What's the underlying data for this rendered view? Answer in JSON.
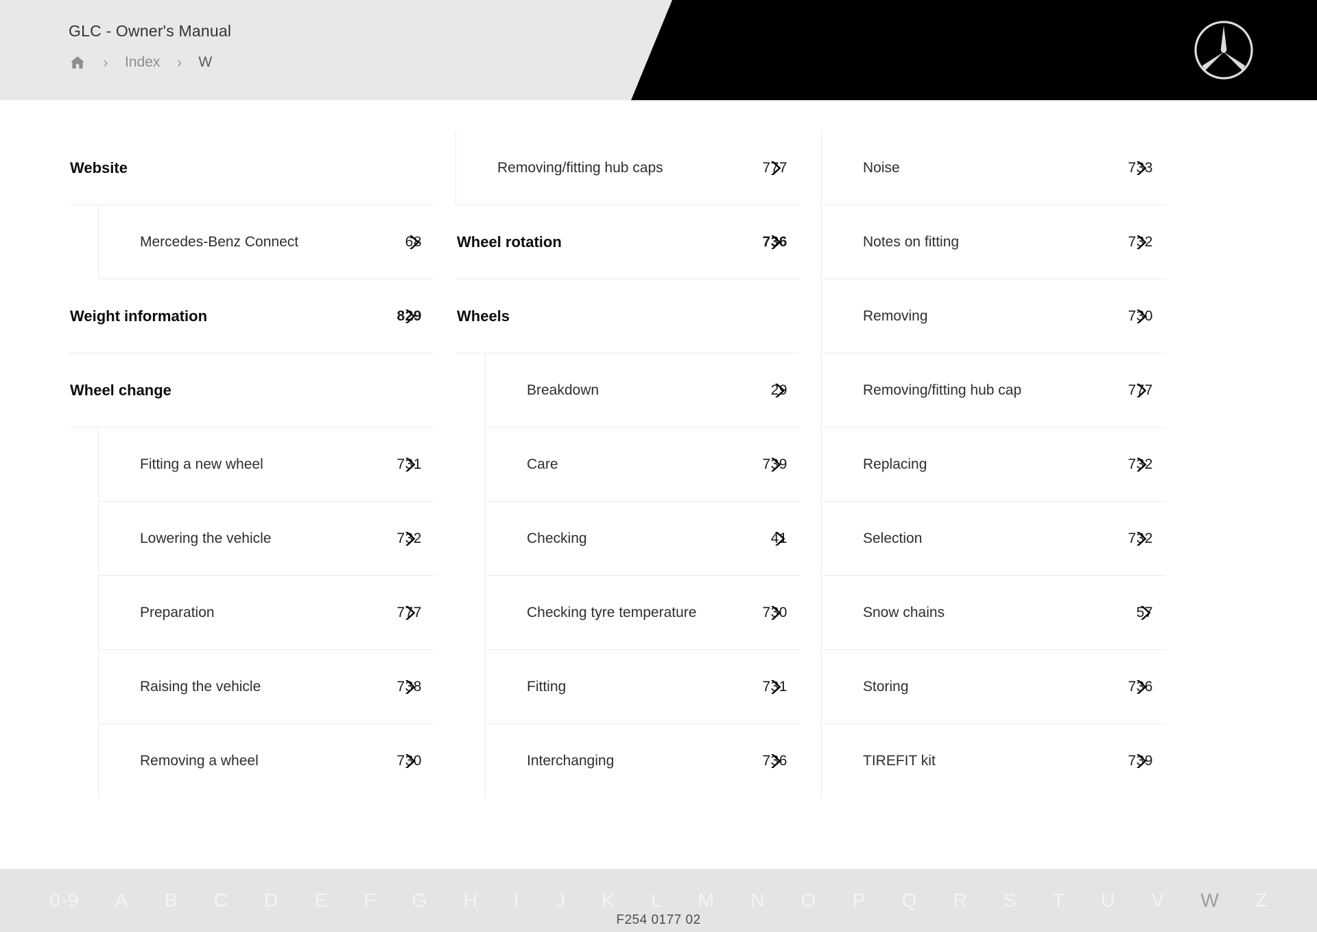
{
  "header": {
    "manual_title": "GLC - Owner's Manual",
    "breadcrumb": {
      "home_icon": "home-icon",
      "separator": "›",
      "index_label": "Index",
      "current_label": "W"
    },
    "logo_icon": "mercedes-benz-star-icon",
    "black_panel_color": "#000000",
    "background_color": "#e8e8e8"
  },
  "columns": [
    {
      "id": "column-1",
      "entries": [
        {
          "label": "Website",
          "page": "",
          "type": "heading",
          "rule": true,
          "chevron": false
        },
        {
          "label": "Mercedes-Benz Connect",
          "page": "68",
          "type": "sub-nested",
          "rule": true,
          "chevron": true
        },
        {
          "label": "Weight information",
          "page": "829",
          "type": "heading",
          "rule": true,
          "chevron": true
        },
        {
          "label": "Wheel change",
          "page": "",
          "type": "heading",
          "rule": true,
          "chevron": false
        },
        {
          "label": "Fitting a new wheel",
          "page": "731",
          "type": "sub-nested",
          "rule": true,
          "chevron": true
        },
        {
          "label": "Lowering the vehicle",
          "page": "732",
          "type": "sub-nested",
          "rule": true,
          "chevron": true
        },
        {
          "label": "Preparation",
          "page": "777",
          "type": "sub-nested",
          "rule": true,
          "chevron": true
        },
        {
          "label": "Raising the vehicle",
          "page": "738",
          "type": "sub-nested",
          "rule": true,
          "chevron": true
        },
        {
          "label": "Removing a wheel",
          "page": "730",
          "type": "sub-nested",
          "rule": false,
          "chevron": true
        }
      ]
    },
    {
      "id": "column-2",
      "entries": [
        {
          "label": "Removing/fitting hub caps",
          "page": "777",
          "type": "sub",
          "rule": true,
          "chevron": true
        },
        {
          "label": "Wheel rotation",
          "page": "736",
          "type": "heading",
          "rule": true,
          "chevron": true
        },
        {
          "label": "Wheels",
          "page": "",
          "type": "heading",
          "rule": true,
          "chevron": false
        },
        {
          "label": "Breakdown",
          "page": "29",
          "type": "sub-nested",
          "rule": true,
          "chevron": true
        },
        {
          "label": "Care",
          "page": "739",
          "type": "sub-nested",
          "rule": true,
          "chevron": true
        },
        {
          "label": "Checking",
          "page": "41",
          "type": "sub-nested",
          "rule": true,
          "chevron": true
        },
        {
          "label": "Checking tyre temperature",
          "page": "730",
          "type": "sub-nested",
          "rule": true,
          "chevron": true
        },
        {
          "label": "Fitting",
          "page": "731",
          "type": "sub-nested",
          "rule": true,
          "chevron": true
        },
        {
          "label": "Interchanging",
          "page": "736",
          "type": "sub-nested",
          "rule": false,
          "chevron": true
        }
      ]
    },
    {
      "id": "column-3",
      "entries": [
        {
          "label": "Noise",
          "page": "733",
          "type": "sub",
          "rule": true,
          "chevron": true
        },
        {
          "label": "Notes on fitting",
          "page": "732",
          "type": "sub",
          "rule": true,
          "chevron": true
        },
        {
          "label": "Removing",
          "page": "730",
          "type": "sub",
          "rule": true,
          "chevron": true
        },
        {
          "label": "Removing/fitting hub cap",
          "page": "777",
          "type": "sub",
          "rule": true,
          "chevron": true
        },
        {
          "label": "Replacing",
          "page": "732",
          "type": "sub",
          "rule": true,
          "chevron": true
        },
        {
          "label": "Selection",
          "page": "732",
          "type": "sub",
          "rule": true,
          "chevron": true
        },
        {
          "label": "Snow chains",
          "page": "57",
          "type": "sub",
          "rule": true,
          "chevron": true
        },
        {
          "label": "Storing",
          "page": "736",
          "type": "sub",
          "rule": true,
          "chevron": true
        },
        {
          "label": "TIREFIT kit",
          "page": "739",
          "type": "sub",
          "rule": false,
          "chevron": true
        }
      ]
    }
  ],
  "footer": {
    "letters": [
      "0-9",
      "A",
      "B",
      "C",
      "D",
      "E",
      "F",
      "G",
      "H",
      "I",
      "J",
      "K",
      "L",
      "M",
      "N",
      "O",
      "P",
      "Q",
      "R",
      "S",
      "T",
      "U",
      "V",
      "W",
      "Z"
    ],
    "active_letter": "W",
    "document_code": "F254 0177 02",
    "background_color": "#e4e4e4"
  }
}
